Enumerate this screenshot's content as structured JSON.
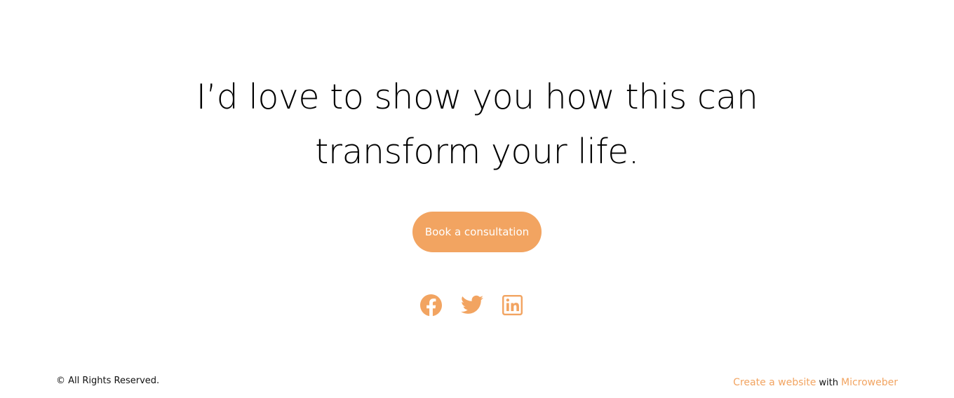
{
  "hero": {
    "headline_line1": "I’d love to show you how this can",
    "headline_line2": "transform your life.",
    "cta_label": "Book a consultation"
  },
  "social": {
    "icons": [
      "facebook-icon",
      "twitter-icon",
      "linkedin-icon"
    ],
    "color": "#f2a461"
  },
  "footer": {
    "copyright": "© All Rights Reserved.",
    "credit_link": "Create a website",
    "credit_with": "with",
    "credit_brand": "Microweber"
  },
  "colors": {
    "accent": "#f2a461",
    "text": "#000000",
    "background": "#ffffff"
  }
}
